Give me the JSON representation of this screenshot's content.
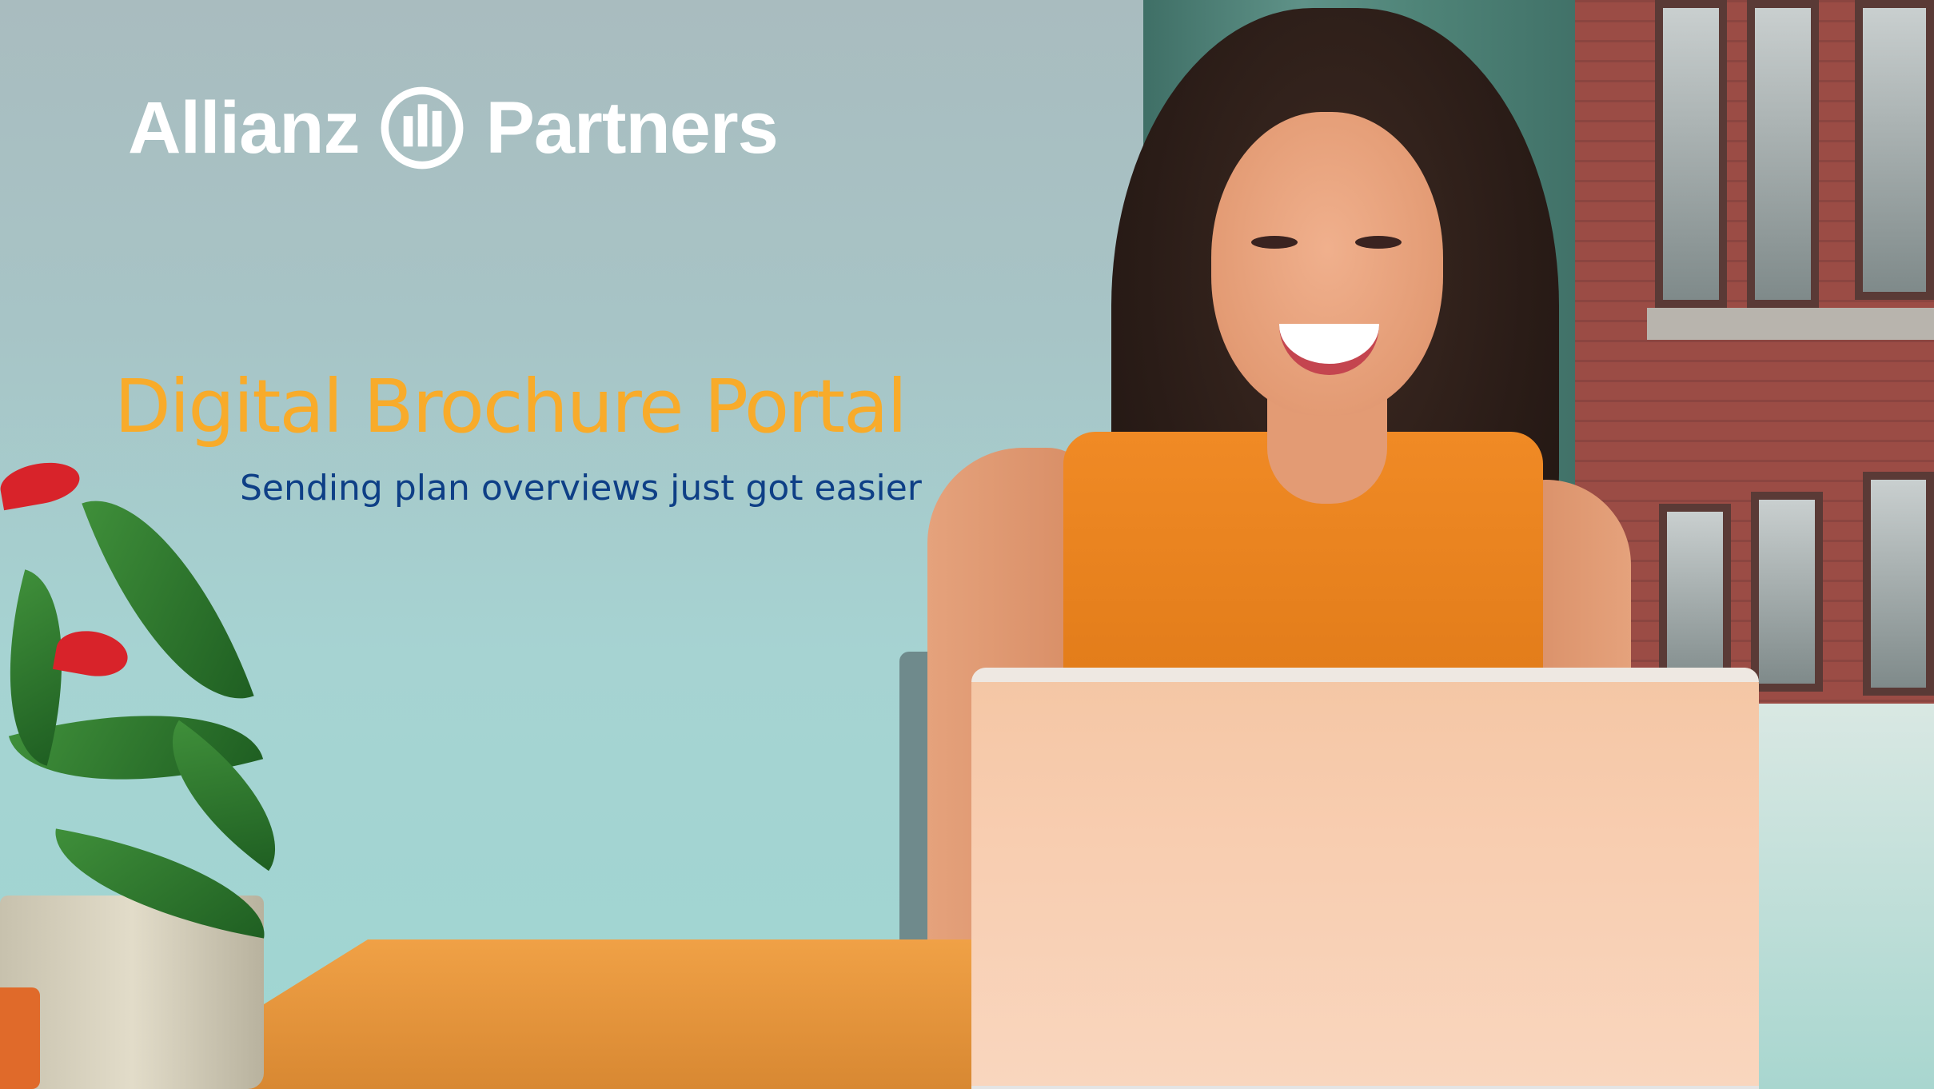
{
  "brand": {
    "name_left": "Allianz",
    "name_right": "Partners",
    "logo_icon": "allianz-eagle-seal-icon",
    "color": "#ffffff"
  },
  "hero": {
    "title": "Digital Brochure Portal",
    "title_color": "#f8ab2a",
    "subtitle": "Sending plan overviews just got easier",
    "subtitle_color": "#0e3f86"
  },
  "background": {
    "image": "woman-smiling-at-laptop-photo"
  }
}
